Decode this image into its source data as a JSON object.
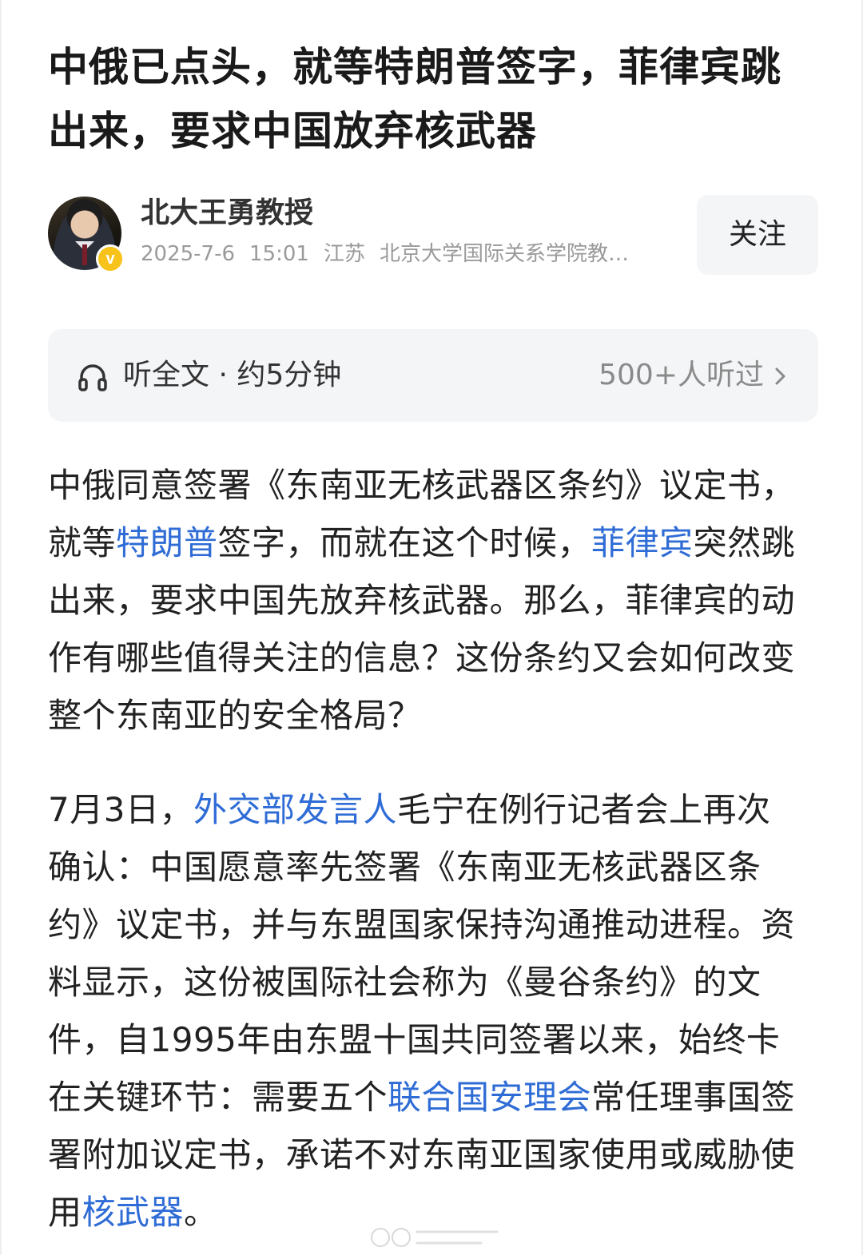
{
  "article": {
    "title": "中俄已点头，就等特朗普签字，菲律宾跳出来，要求中国放弃核武器"
  },
  "author": {
    "name": "北大王勇教授",
    "date": "2025-7-6",
    "time": "15:01",
    "location": "江苏",
    "description": "北京大学国际关系学院教…",
    "follow_label": "关注"
  },
  "listen": {
    "label": "听全文 · 约5分钟",
    "count": "500+人听过",
    "icon": "headphones-icon",
    "chevron": "chevron-right-icon"
  },
  "body": {
    "p1": {
      "t1": "中俄同意签署《东南亚无核武器区条约》议定书，就等",
      "link1": "特朗普",
      "t2": "签字，而就在这个时候，",
      "link2": "菲律宾",
      "t3": "突然跳出来，要求中国先放弃核武器。那么，菲律宾的动作有哪些值得关注的信息？这份条约又会如何改变整个东南亚的安全格局？"
    },
    "p2": {
      "t1": "7月3日，",
      "link1": "外交部发言人",
      "t2": "毛宁在例行记者会上再次确认：中国愿意率先签署《东南亚无核武器区条约》议定书，并与东盟国家保持沟通推动进程。资料显示，这份被国际社会称为《曼谷条约》的文件，自1995年由东盟十国共同签署以来，始终卡在关键环节：需要五个",
      "link2": "联合国安理会",
      "t3": "常任理事国签署附加议定书，承诺不对东南亚国家使用或威胁使用",
      "link3": "核武器",
      "t4": "。"
    }
  },
  "colors": {
    "link": "#2f6cd6",
    "text": "#222222",
    "meta": "#9a9a9a",
    "panel": "#f4f5f7",
    "badge": "#f7c21a"
  }
}
